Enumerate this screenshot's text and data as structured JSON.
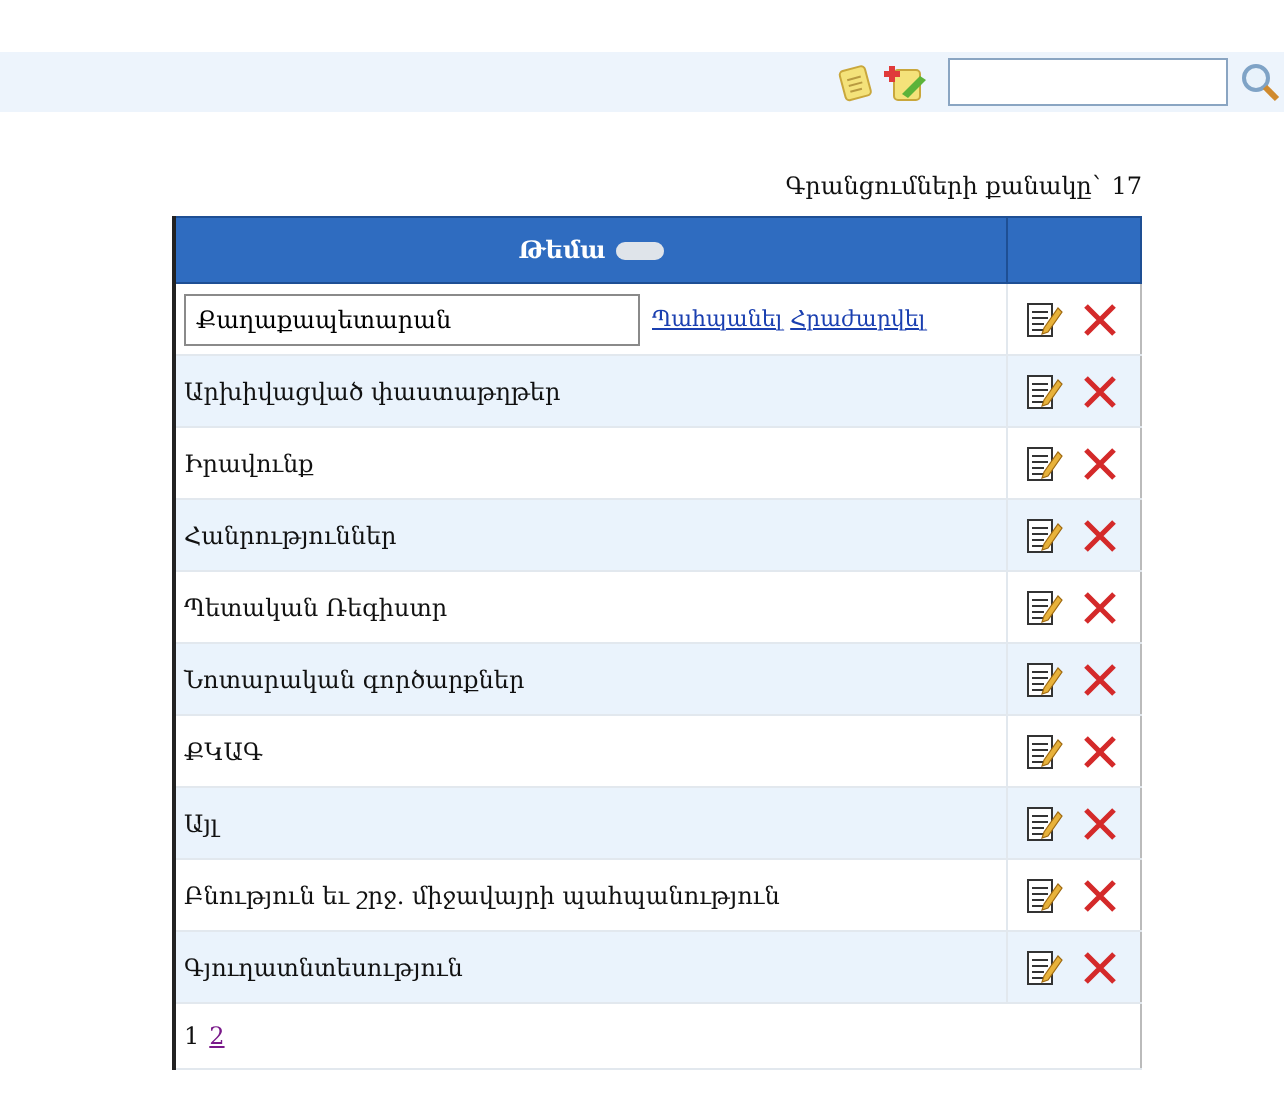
{
  "record_count": "Գրանցումների քանակը` 17",
  "table": {
    "columns": [
      {
        "label": "Թեմա",
        "sortable": true
      }
    ],
    "rows": [
      {
        "kind": "edit",
        "value": "Քաղաքապետարան",
        "save": "Պահպանել",
        "cancel": "Հրաժարվել"
      },
      {
        "kind": "text",
        "label": "Արխիվացված փաստաթղթեր"
      },
      {
        "kind": "text",
        "label": "Իրավունք"
      },
      {
        "kind": "text",
        "label": "Հանրություններ"
      },
      {
        "kind": "text",
        "label": "Պետական Ռեգիստր"
      },
      {
        "kind": "text",
        "label": "Նոտարական գործարքներ"
      },
      {
        "kind": "text",
        "label": "ՔԿԱԳ"
      },
      {
        "kind": "text",
        "label": "Այլ"
      },
      {
        "kind": "text",
        "label": "Բնություն եւ շրջ. միջավայրի պահպանություն"
      },
      {
        "kind": "text",
        "label": "Գյուղատնտեսություն"
      }
    ],
    "pages": [
      {
        "label": "1",
        "selected": true
      },
      {
        "label": "2",
        "selected": false
      }
    ]
  }
}
